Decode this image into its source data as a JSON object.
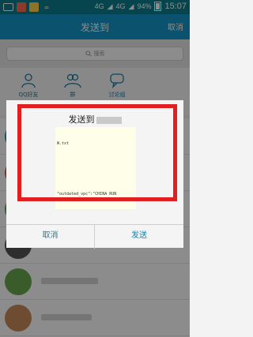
{
  "status_bar": {
    "icons": [
      "mail-icon",
      "app-icon",
      "app-icon",
      "infinity-icon"
    ],
    "network_1": "4G",
    "network_2": "4G",
    "battery": "94%",
    "time": "15:07"
  },
  "header": {
    "title": "发送到",
    "cancel_label": "取消"
  },
  "search": {
    "placeholder": "搜索"
  },
  "quick_targets": [
    {
      "label": "QQ好友",
      "icon": "person-icon"
    },
    {
      "label": "群",
      "icon": "group-icon"
    },
    {
      "label": "讨论组",
      "icon": "chat-bubble-icon"
    }
  ],
  "dialog": {
    "title": "发送到",
    "preview_line1": "W.txt",
    "preview_line2": "\"outdated_vpc\":\"CHINA RUN",
    "cancel_label": "取消",
    "send_label": "发送"
  },
  "colors": {
    "accent": "#1496c9",
    "status_bar": "#0c7f8f",
    "highlight": "#e02020",
    "link": "#1a7da6"
  }
}
